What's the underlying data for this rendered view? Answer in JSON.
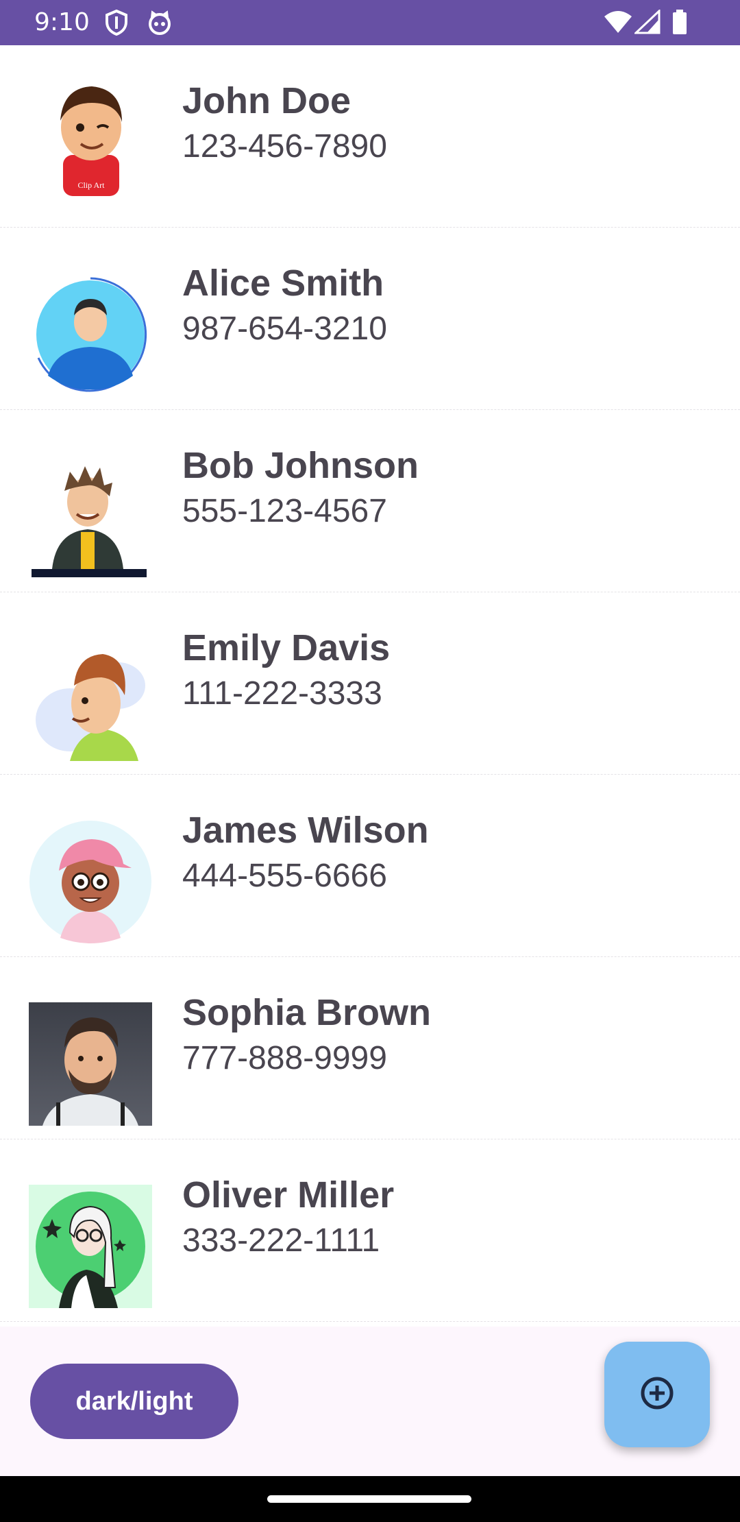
{
  "status_bar": {
    "time": "9:10",
    "left_icons": [
      "shield-icon",
      "cat-face-icon"
    ],
    "right_icons": [
      "wifi-icon",
      "signal-icon",
      "battery-icon"
    ],
    "background": "#6750a4"
  },
  "contacts": [
    {
      "name": "John Doe",
      "phone": "123-456-7890",
      "avatar": "cartoon-boy-red-shirt-avatar"
    },
    {
      "name": "Alice Smith",
      "phone": "987-654-3210",
      "avatar": "man-blue-shirt-circle-avatar"
    },
    {
      "name": "Bob Johnson",
      "phone": "555-123-4567",
      "avatar": "cartoon-man-jacket-avatar"
    },
    {
      "name": "Emily Davis",
      "phone": "111-222-3333",
      "avatar": "cartoon-profile-man-avatar"
    },
    {
      "name": "James Wilson",
      "phone": "444-555-6666",
      "avatar": "cartoon-girl-pink-cap-avatar"
    },
    {
      "name": "Sophia Brown",
      "phone": "777-888-9999",
      "avatar": "bearded-man-3d-avatar"
    },
    {
      "name": "Oliver Miller",
      "phone": "333-222-1111",
      "avatar": "woman-glasses-green-circle-avatar"
    }
  ],
  "bottom_bar": {
    "toggle_label": "dark/light",
    "fab_icon": "add-circle-icon"
  },
  "colors": {
    "primary": "#6750a4",
    "fab": "#7fbdf0",
    "text": "#49454f",
    "bottom_background": "#fdf6fd"
  }
}
